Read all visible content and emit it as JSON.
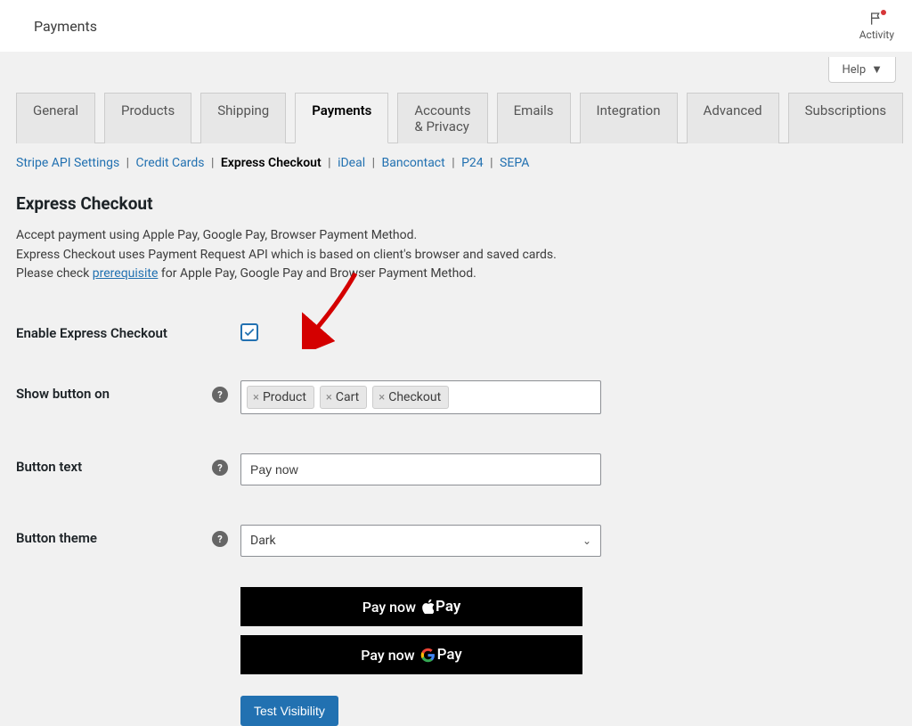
{
  "topbar": {
    "title": "Payments",
    "activity_label": "Activity"
  },
  "help_button": "Help",
  "tabs": [
    "General",
    "Products",
    "Shipping",
    "Payments",
    "Accounts & Privacy",
    "Emails",
    "Integration",
    "Advanced",
    "Subscriptions"
  ],
  "active_tab": "Payments",
  "subnav": [
    "Stripe API Settings",
    "Credit Cards",
    "Express Checkout",
    "iDeal",
    "Bancontact",
    "P24",
    "SEPA"
  ],
  "active_subnav": "Express Checkout",
  "section": {
    "title": "Express Checkout",
    "desc_line1": "Accept payment using Apple Pay, Google Pay, Browser Payment Method.",
    "desc_line2": "Express Checkout uses Payment Request API which is based on client's browser and saved cards.",
    "desc_line3a": "Please check ",
    "desc_line3_link": "prerequisite",
    "desc_line3b": " for Apple Pay, Google Pay and Browser Payment Method."
  },
  "fields": {
    "enable": {
      "label": "Enable Express Checkout",
      "checked": true
    },
    "show_on": {
      "label": "Show button on",
      "tags": [
        "Product",
        "Cart",
        "Checkout"
      ]
    },
    "button_text": {
      "label": "Button text",
      "value": "Pay now"
    },
    "button_theme": {
      "label": "Button theme",
      "value": "Dark"
    }
  },
  "preview": {
    "apple_prefix": "Pay now",
    "apple_brand": "Pay",
    "gpay_prefix": "Pay now",
    "gpay_brand": "Pay"
  },
  "test_visibility": "Test Visibility"
}
